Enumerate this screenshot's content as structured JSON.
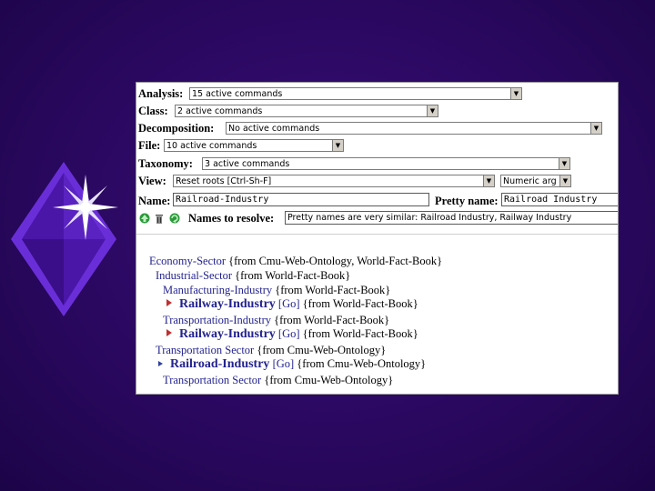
{
  "colors": {
    "background": "#2a0860",
    "link": "#23238e",
    "diamond": "#6a2ed8"
  },
  "form": {
    "analysis": {
      "label": "Analysis:",
      "value": "15 active commands"
    },
    "class": {
      "label": "Class:",
      "value": "2 active commands"
    },
    "decomposition": {
      "label": "Decomposition:",
      "value": "No active commands"
    },
    "file": {
      "label": "File:",
      "value": "10 active commands"
    },
    "taxonomy": {
      "label": "Taxonomy:",
      "value": "3 active commands"
    },
    "view": {
      "label": "View:",
      "value": "Reset roots [Ctrl-Sh-F]",
      "value2": "Numeric arg"
    },
    "name": {
      "label": "Name:",
      "value": "Railroad-Industry"
    },
    "pretty_name": {
      "label": "Pretty name:",
      "value": "Railroad Industry"
    },
    "resolve": {
      "label": "Names to resolve:",
      "value": "Pretty names are very similar: Railroad Industry, Railway Industry"
    }
  },
  "tree": [
    {
      "name": "Economy-Sector",
      "source": "{from Cmu-Web-Ontology, World-Fact-Book}"
    },
    {
      "name": "Industrial-Sector",
      "source": "{from World-Fact-Book}"
    },
    {
      "name": "Manufacturing-Industry",
      "source": "{from World-Fact-Book}"
    },
    {
      "name": "Railway-Industry",
      "go": "[Go]",
      "source": "{from World-Fact-Book}"
    },
    {
      "name": "Transportation-Industry",
      "source": "{from World-Fact-Book}"
    },
    {
      "name": "Railway-Industry",
      "go": "[Go]",
      "source": "{from World-Fact-Book}"
    },
    {
      "name": "Transportation Sector",
      "source": "{from Cmu-Web-Ontology}"
    },
    {
      "name": "Railroad-Industry",
      "go": "[Go]",
      "source": "{from Cmu-Web-Ontology}"
    },
    {
      "name": "Transportation Sector",
      "source": "{from Cmu-Web-Ontology}"
    }
  ]
}
